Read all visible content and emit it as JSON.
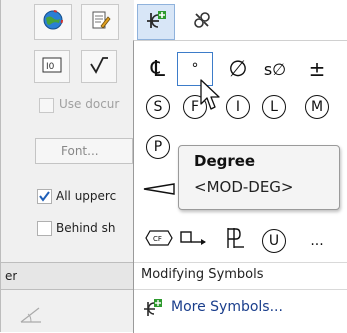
{
  "left_panel": {
    "use_document_label": "Use docur",
    "font_button": "Font...",
    "all_uppercase_label": "All upperc",
    "all_uppercase_checked": true,
    "behind_sheet_label": "Behind sh",
    "section_header": "er"
  },
  "menu": {
    "symbols_row1": [
      "℄",
      "°",
      "∅",
      "s∅",
      "±"
    ],
    "symbols_row2": [
      "S",
      "F",
      "I",
      "L",
      "M"
    ],
    "symbols_row3": [
      "P"
    ],
    "symbols_row5": [
      "CF",
      "",
      "",
      "U",
      "..."
    ],
    "section_label": "Modifying Symbols",
    "more_symbols_label": "More Symbols..."
  },
  "tooltip": {
    "title": "Degree",
    "code": "<MOD-DEG>"
  },
  "colors": {
    "accent": "#0a64c8",
    "hover_border": "#3d7cc9",
    "more_symbols_text": "#1a3e8c"
  }
}
